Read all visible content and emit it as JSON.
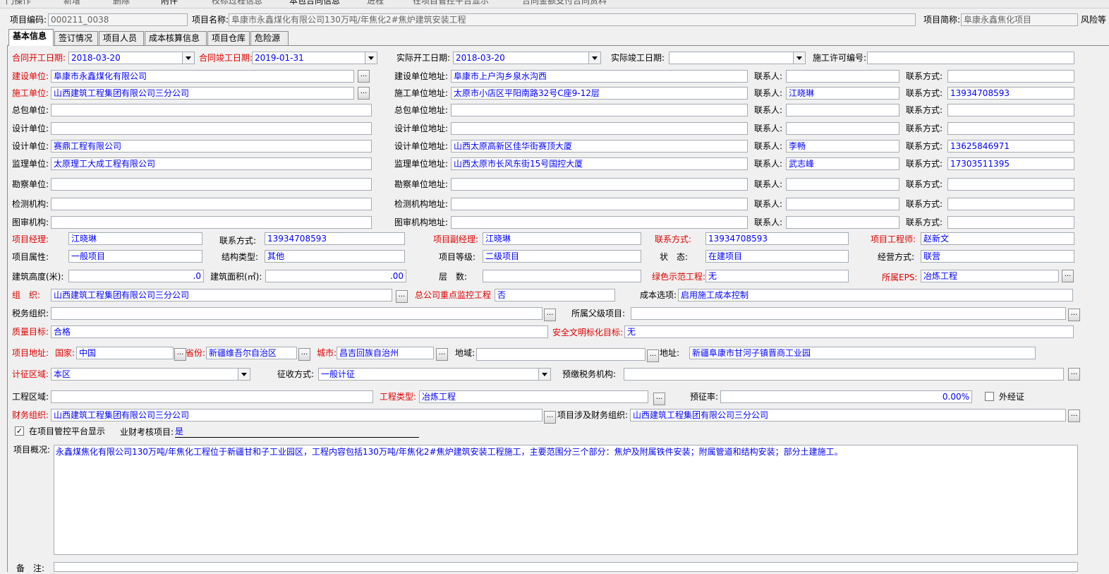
{
  "toolbar": {
    "items": [
      "门操作",
      "新增",
      "删除",
      "附件",
      "校标过程信息",
      "本包合同信息",
      "进程",
      "在项目管控平台显示",
      "合同金额支付合同资料"
    ]
  },
  "header": {
    "code_label": "项目编码:",
    "code": "000211_0038",
    "name_label": "项目名称:",
    "name": "阜康市永鑫煤化有限公司130万吨/年焦化2#焦炉建筑安装工程",
    "short_label": "项目简称:",
    "short": "阜康永鑫焦化项目",
    "risk_label": "风险等"
  },
  "tabs": [
    "基本信息",
    "签订情况",
    "项目人员",
    "成本核算信息",
    "项目仓库",
    "危险源"
  ],
  "dates": {
    "contract_start_label": "合同开工日期:",
    "contract_start": "2018-03-20",
    "contract_end_label": "合同竣工日期:",
    "contract_end": "2019-01-31",
    "actual_start_label": "实际开工日期:",
    "actual_start": "2018-03-20",
    "actual_end_label": "实际竣工日期:",
    "actual_end": "",
    "permit_label": "施工许可编号:",
    "permit": ""
  },
  "units": [
    {
      "label": "建设单位:",
      "red": true,
      "name": "阜康市永鑫煤化有限公司",
      "addr_label": "建设单位地址:",
      "addr": "阜康市上户沟乡泉水沟西",
      "contact_label": "联系人:",
      "contact": "",
      "phone_label": "联系方式:",
      "phone": ""
    },
    {
      "label": "施工单位:",
      "red": true,
      "name": "山西建筑工程集团有限公司三分公司",
      "addr_label": "施工单位地址:",
      "addr": "太原市小店区平阳南路32号C座9-12层",
      "contact_label": "联系人:",
      "contact": "江晓琳",
      "phone_label": "联系方式:",
      "phone": "13934708593"
    },
    {
      "label": "总包单位:",
      "red": false,
      "name": "",
      "addr_label": "总包单位地址:",
      "addr": "",
      "contact_label": "联系人:",
      "contact": "",
      "phone_label": "联系方式:",
      "phone": ""
    },
    {
      "label": "设计单位:",
      "red": false,
      "name": "",
      "addr_label": "设计单位地址:",
      "addr": "",
      "contact_label": "联系人:",
      "contact": "",
      "phone_label": "联系方式:",
      "phone": ""
    },
    {
      "label": "设计单位:",
      "red": false,
      "name": "赛鼎工程有限公司",
      "addr_label": "设计单位地址:",
      "addr": "山西太原高新区佳华街赛顶大厦",
      "contact_label": "联系人:",
      "contact": "李畅",
      "phone_label": "联系方式:",
      "phone": "13625846971"
    },
    {
      "label": "监理单位:",
      "red": false,
      "name": "太原理工大成工程有限公司",
      "addr_label": "监理单位地址:",
      "addr": "山西太原市长风东街15号国控大厦",
      "contact_label": "联系人:",
      "contact": "武志峰",
      "phone_label": "联系方式:",
      "phone": "17303511395"
    },
    {
      "label": "勘察单位:",
      "red": false,
      "name": "",
      "addr_label": "勘察单位地址:",
      "addr": "",
      "contact_label": "联系人:",
      "contact": "",
      "phone_label": "联系方式:",
      "phone": ""
    },
    {
      "label": "检测机构:",
      "red": false,
      "name": "",
      "addr_label": "检测机构地址:",
      "addr": "",
      "contact_label": "联系人:",
      "contact": "",
      "phone_label": "联系方式:",
      "phone": ""
    },
    {
      "label": "图审机构:",
      "red": false,
      "name": "",
      "addr_label": "图审机构地址:",
      "addr": "",
      "contact_label": "联系人:",
      "contact": "",
      "phone_label": "联系方式:",
      "phone": ""
    }
  ],
  "people": {
    "pm_label": "项目经理:",
    "pm": "江晓琳",
    "pm_phone_label": "联系方式:",
    "pm_phone": "13934708593",
    "dpm_label": "项目副经理:",
    "dpm": "江晓琳",
    "dpm_phone_label": "联系方式:",
    "dpm_phone": "13934708593",
    "eng_label": "项目工程师:",
    "eng": "赵新文"
  },
  "attrs": {
    "prop_label": "项目属性:",
    "prop": "一般项目",
    "struct_label": "结构类型:",
    "struct": "其他",
    "level_label": "项目等级:",
    "level": "二级项目",
    "status_label": "状　态:",
    "status": "在建项目",
    "mode_label": "经营方式:",
    "mode": "联营"
  },
  "build": {
    "height_label": "建筑高度(米):",
    "height": ".0",
    "area_label": "建筑面积(㎡):",
    "area": ".00",
    "floors_label": "层　数:",
    "floors": "",
    "green_label": "绿色示范工程:",
    "green": "无",
    "eps_label": "所属EPS:",
    "eps": "冶炼工程"
  },
  "org": {
    "org_label": "组　织:",
    "org": "山西建筑工程集团有限公司三分公司",
    "key_label": "总公司重点监控工程",
    "key": "否",
    "cost_label": "成本选项:",
    "cost": "启用施工成本控制",
    "tax_label": "税务组织:",
    "tax": "",
    "parent_label": "所属父级项目:",
    "parent": "",
    "quality_label": "质量目标:",
    "quality": "合格",
    "safety_label": "安全文明标化目标:",
    "safety": "无"
  },
  "address": {
    "label": "项目地址:",
    "country_label": "国家:",
    "country": "中国",
    "province_label": "省份:",
    "province": "新疆维吾尔自治区",
    "city_label": "城市:",
    "city": "昌吉回族自治州",
    "region_label": "地域:",
    "region": "",
    "addr_label": "地址:",
    "addr": "新疆阜康市甘河子镇晋商工业园"
  },
  "tax": {
    "area_label": "计征区域:",
    "area": "本区",
    "method_label": "征收方式:",
    "method": "一般计征",
    "prepay_label": "预缴税务机构:",
    "prepay": "",
    "proj_area_label": "工程区域:",
    "proj_area": "",
    "type_label": "工程类型:",
    "type": "冶炼工程",
    "rate_label": "预征率:",
    "rate": "0.00%",
    "outside_label": "外经证"
  },
  "finance": {
    "org_label": "财务组织:",
    "org": "山西建筑工程集团有限公司三分公司",
    "rel_label": "项目涉及财务组织:",
    "rel": "山西建筑工程集团有限公司三分公司",
    "show_label": "在项目管控平台显示",
    "assess_label": "业财考核项目:",
    "assess": "是"
  },
  "overview": {
    "label": "项目概况:",
    "text": "永鑫煤焦化有限公司130万吨/年焦化工程位于新疆甘和子工业园区，工程内容包括130万吨/年焦化2#焦炉建筑安装工程施工，主要范围分三个部分：焦炉及附属铁件安装；附属管道和结构安装；部分土建施工。"
  },
  "remark": {
    "label": "备　注:",
    "text": ""
  }
}
